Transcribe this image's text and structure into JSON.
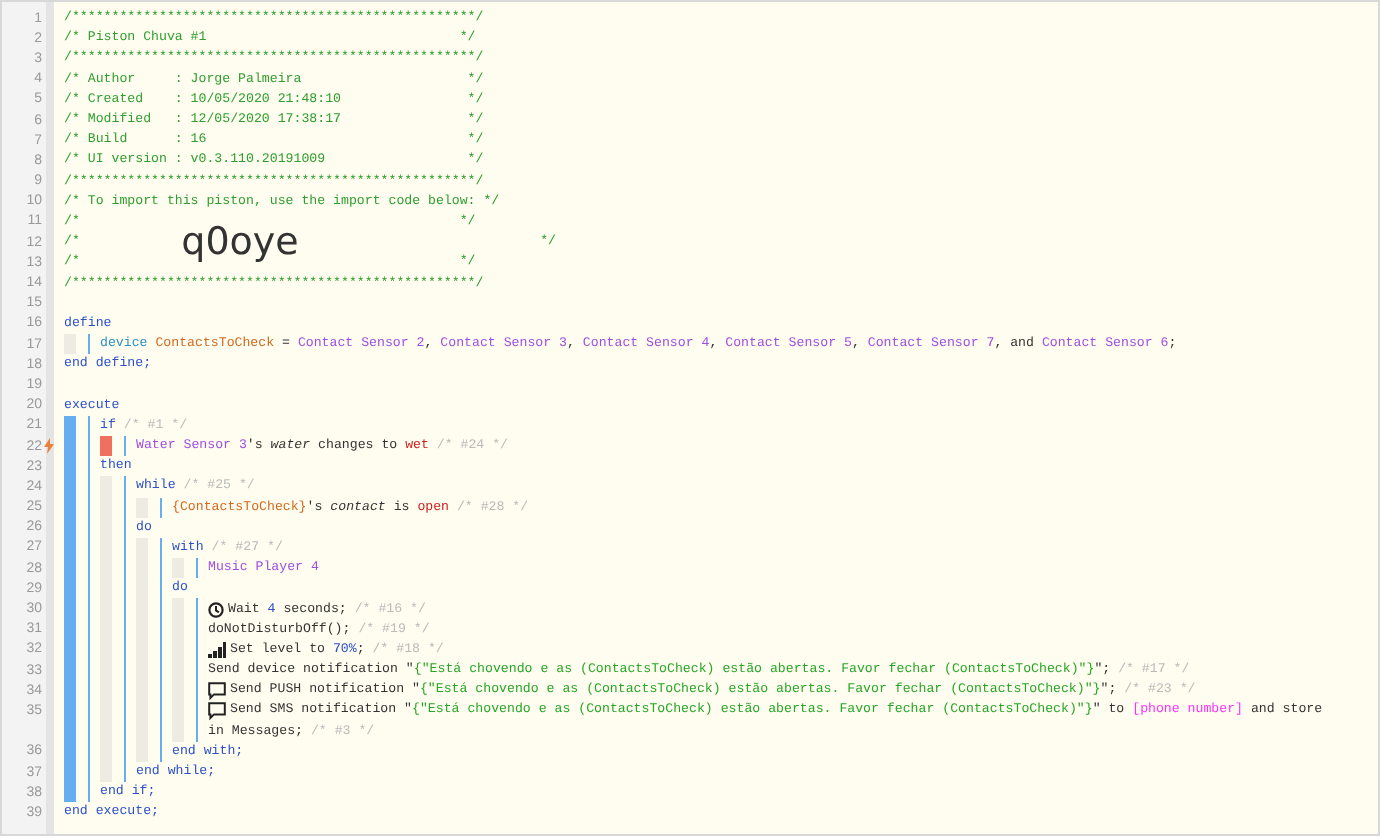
{
  "lines": [
    {
      "number": "1",
      "tokens": [
        {
          "kind": "comment",
          "text": "/***************************************************/"
        }
      ]
    },
    {
      "number": "2",
      "tokens": [
        {
          "kind": "comment",
          "text": "/* Piston Chuva #1                                */"
        }
      ]
    },
    {
      "number": "3",
      "tokens": [
        {
          "kind": "comment",
          "text": "/***************************************************/"
        }
      ]
    },
    {
      "number": "4",
      "tokens": [
        {
          "kind": "comment",
          "text": "/* Author     : Jorge Palmeira                     */"
        }
      ]
    },
    {
      "number": "5",
      "tokens": [
        {
          "kind": "comment",
          "text": "/* Created    : 10/05/2020 21:48:10                */"
        }
      ]
    },
    {
      "number": "6",
      "tokens": [
        {
          "kind": "comment",
          "text": "/* Modified   : 12/05/2020 17:38:17                */"
        }
      ]
    },
    {
      "number": "7",
      "tokens": [
        {
          "kind": "comment",
          "text": "/* Build      : 16                                 */"
        }
      ]
    },
    {
      "number": "8",
      "tokens": [
        {
          "kind": "comment",
          "text": "/* UI version : v0.3.110.20191009                  */"
        }
      ]
    },
    {
      "number": "9",
      "tokens": [
        {
          "kind": "comment",
          "text": "/***************************************************/"
        }
      ]
    },
    {
      "number": "10",
      "tokens": [
        {
          "kind": "comment",
          "text": "/* To import this piston, use the import code below: */"
        }
      ]
    },
    {
      "number": "11",
      "tokens": [
        {
          "kind": "comment",
          "text": "/*                                                */"
        }
      ]
    },
    {
      "number": "12",
      "tokens": [
        {
          "kind": "comment",
          "text": "/*"
        },
        {
          "kind": "import-code",
          "text": "q0oye"
        },
        {
          "kind": "comment",
          "text": "*/"
        }
      ]
    },
    {
      "number": "13",
      "tokens": [
        {
          "kind": "comment",
          "text": "/*                                                */"
        }
      ]
    },
    {
      "number": "14",
      "tokens": [
        {
          "kind": "comment",
          "text": "/***************************************************/"
        }
      ]
    },
    {
      "number": "15"
    },
    {
      "number": "16",
      "tokens": [
        {
          "kind": "keyword",
          "text": "define"
        }
      ],
      "children": [
        {
          "number": "17",
          "tokens": [
            {
              "kind": "type",
              "text": "device "
            },
            {
              "kind": "variable",
              "text": "ContactsToCheck"
            },
            {
              "kind": "plain",
              "text": " = "
            },
            {
              "kind": "device",
              "text": "Contact Sensor 2"
            },
            {
              "kind": "plain",
              "text": ", "
            },
            {
              "kind": "device",
              "text": "Contact Sensor 3"
            },
            {
              "kind": "plain",
              "text": ", "
            },
            {
              "kind": "device",
              "text": "Contact Sensor 4"
            },
            {
              "kind": "plain",
              "text": ", "
            },
            {
              "kind": "device",
              "text": "Contact Sensor 5"
            },
            {
              "kind": "plain",
              "text": ", "
            },
            {
              "kind": "device",
              "text": "Contact Sensor 7"
            },
            {
              "kind": "plain",
              "text": ", and "
            },
            {
              "kind": "device",
              "text": "Contact Sensor 6"
            },
            {
              "kind": "plain",
              "text": ";"
            }
          ]
        }
      ]
    },
    {
      "number": "18",
      "tokens": [
        {
          "kind": "keyword",
          "text": "end define;"
        }
      ]
    },
    {
      "number": "19"
    },
    {
      "number": "20",
      "kind": "execute",
      "tokens": [
        {
          "kind": "keyword",
          "text": "execute"
        }
      ],
      "children": [
        {
          "number": "21",
          "tokens": [
            {
              "kind": "keyword",
              "text": "if "
            },
            {
              "kind": "note",
              "text": "/* #1 */"
            }
          ],
          "children": [
            {
              "number": "22",
              "kind": "trigger",
              "tokens": [
                {
                  "kind": "device",
                  "text": "Water Sensor 3"
                },
                {
                  "kind": "plain",
                  "text": "'s "
                },
                {
                  "kind": "attribute",
                  "text": "water"
                },
                {
                  "kind": "plain",
                  "text": " changes to "
                },
                {
                  "kind": "value",
                  "text": "wet"
                },
                {
                  "kind": "note",
                  "text": " /* #24 */"
                }
              ]
            }
          ]
        },
        {
          "number": "23",
          "tokens": [
            {
              "kind": "keyword",
              "text": "then"
            }
          ],
          "children": [
            {
              "number": "24",
              "tokens": [
                {
                  "kind": "keyword",
                  "text": "while "
                },
                {
                  "kind": "note",
                  "text": "/* #25 */"
                }
              ],
              "children": [
                {
                  "number": "25",
                  "tokens": [
                    {
                      "kind": "variable",
                      "text": "{ContactsToCheck}"
                    },
                    {
                      "kind": "plain",
                      "text": "'s "
                    },
                    {
                      "kind": "attribute",
                      "text": "contact"
                    },
                    {
                      "kind": "plain",
                      "text": " is "
                    },
                    {
                      "kind": "value",
                      "text": "open"
                    },
                    {
                      "kind": "note",
                      "text": " /* #28 */"
                    }
                  ]
                }
              ]
            },
            {
              "number": "26",
              "tokens": [
                {
                  "kind": "keyword",
                  "text": "do"
                }
              ],
              "children": [
                {
                  "number": "27",
                  "tokens": [
                    {
                      "kind": "keyword",
                      "text": "with "
                    },
                    {
                      "kind": "note",
                      "text": "/* #27 */"
                    }
                  ],
                  "children": [
                    {
                      "number": "28",
                      "tokens": [
                        {
                          "kind": "device",
                          "text": "Music Player 4"
                        }
                      ]
                    }
                  ]
                },
                {
                  "number": "29",
                  "tokens": [
                    {
                      "kind": "keyword",
                      "text": "do"
                    }
                  ],
                  "children": [
                    {
                      "number": "30",
                      "kind": "wait",
                      "tokens": [
                        {
                          "kind": "plain",
                          "text": "Wait "
                        },
                        {
                          "kind": "number",
                          "text": "4"
                        },
                        {
                          "kind": "plain",
                          "text": " seconds; "
                        },
                        {
                          "kind": "note",
                          "text": "/* #16 */"
                        }
                      ]
                    },
                    {
                      "number": "31",
                      "tokens": [
                        {
                          "kind": "plain",
                          "text": "doNotDisturbOff(); "
                        },
                        {
                          "kind": "note",
                          "text": "/* #19 */"
                        }
                      ]
                    },
                    {
                      "number": "32",
                      "kind": "level",
                      "tokens": [
                        {
                          "kind": "plain",
                          "text": "Set level to "
                        },
                        {
                          "kind": "number",
                          "text": "70%"
                        },
                        {
                          "kind": "plain",
                          "text": "; "
                        },
                        {
                          "kind": "note",
                          "text": "/* #18 */"
                        }
                      ]
                    },
                    {
                      "number": "33",
                      "tokens": [
                        {
                          "kind": "plain",
                          "text": "Send device notification \""
                        },
                        {
                          "kind": "string",
                          "text": "{\"Está chovendo e as (ContactsToCheck) estão abertas. Favor fechar (ContactsToCheck)\"}"
                        },
                        {
                          "kind": "plain",
                          "text": "\"; "
                        },
                        {
                          "kind": "note",
                          "text": "/* #17 */"
                        }
                      ]
                    },
                    {
                      "number": "34",
                      "kind": "message",
                      "tokens": [
                        {
                          "kind": "plain",
                          "text": "Send PUSH notification \""
                        },
                        {
                          "kind": "string",
                          "text": "{\"Está chovendo e as (ContactsToCheck) estão abertas. Favor fechar (ContactsToCheck)\"}"
                        },
                        {
                          "kind": "plain",
                          "text": "\"; "
                        },
                        {
                          "kind": "note",
                          "text": "/* #23 */"
                        }
                      ]
                    },
                    {
                      "number": "35",
                      "kind": "message",
                      "tokens": [
                        {
                          "kind": "plain",
                          "text": "Send SMS notification \""
                        },
                        {
                          "kind": "string",
                          "text": "{\"Está chovendo e as (ContactsToCheck) estão abertas. Favor fechar (ContactsToCheck)\"}"
                        },
                        {
                          "kind": "plain",
                          "text": "\" to "
                        },
                        {
                          "kind": "placeholder",
                          "text": "[phone number]"
                        },
                        {
                          "kind": "plain",
                          "text": " and store"
                        }
                      ],
                      "continuation": [
                        {
                          "kind": "plain",
                          "text": "in Messages; "
                        },
                        {
                          "kind": "note",
                          "text": "/* #3 */"
                        }
                      ]
                    }
                  ]
                },
                {
                  "number": "36",
                  "tokens": [
                    {
                      "kind": "keyword",
                      "text": "end with;"
                    }
                  ]
                }
              ]
            },
            {
              "number": "37",
              "tokens": [
                {
                  "kind": "keyword",
                  "text": "end while;"
                }
              ]
            }
          ]
        },
        {
          "number": "38",
          "tokens": [
            {
              "kind": "keyword",
              "text": "end if;"
            }
          ]
        }
      ]
    },
    {
      "number": "39",
      "tokens": [
        {
          "kind": "keyword",
          "text": "end execute;"
        }
      ]
    }
  ]
}
